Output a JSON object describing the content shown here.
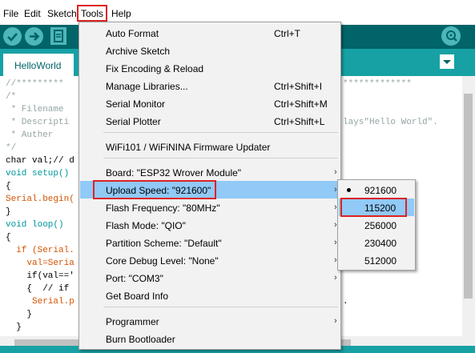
{
  "menubar": {
    "items": [
      "File",
      "Edit",
      "Sketch",
      "Tools",
      "Help"
    ]
  },
  "toolbar": {
    "buttons": [
      "verify-icon",
      "upload-icon",
      "new-icon",
      "serial-monitor-icon"
    ]
  },
  "tab": {
    "name": "HelloWorld"
  },
  "editor": {
    "lines": [
      {
        "text": "//*********",
        "cls": "c-com"
      },
      {
        "text": "/*",
        "cls": "c-com"
      },
      {
        "text": " * Filename",
        "cls": "c-com"
      },
      {
        "text": " * Descripti",
        "cls": "c-com"
      },
      {
        "text": " * Auther",
        "cls": "c-com"
      },
      {
        "text": "*/",
        "cls": "c-com"
      },
      {
        "text": "char val;// d",
        "cls": ""
      },
      {
        "text": "void setup()",
        "cls": "c-kw"
      },
      {
        "text": "{",
        "cls": ""
      },
      {
        "text": "Serial.begin(",
        "cls": "c-fn"
      },
      {
        "text": "}",
        "cls": ""
      },
      {
        "text": "void loop()",
        "cls": "c-kw"
      },
      {
        "text": "{",
        "cls": ""
      },
      {
        "text": "  if (Serial.",
        "cls": "c-fn"
      },
      {
        "text": "    val=Seria",
        "cls": "c-fn"
      },
      {
        "text": "    if(val=='",
        "cls": ""
      },
      {
        "text": "    {  // if",
        "cls": ""
      },
      {
        "text": "     Serial.p",
        "cls": "c-fn"
      },
      {
        "text": "    }",
        "cls": ""
      },
      {
        "text": "  }",
        "cls": ""
      }
    ],
    "right_fragments": {
      "stars": "*************",
      "hello": "lays\"Hello World\".",
      "dot": "."
    }
  },
  "tools_menu": {
    "items": [
      {
        "label": "Auto Format",
        "shortcut": "Ctrl+T",
        "submenu": false
      },
      {
        "label": "Archive Sketch",
        "shortcut": "",
        "submenu": false
      },
      {
        "label": "Fix Encoding & Reload",
        "shortcut": "",
        "submenu": false
      },
      {
        "label": "Manage Libraries...",
        "shortcut": "Ctrl+Shift+I",
        "submenu": false
      },
      {
        "label": "Serial Monitor",
        "shortcut": "Ctrl+Shift+M",
        "submenu": false
      },
      {
        "label": "Serial Plotter",
        "shortcut": "Ctrl+Shift+L",
        "submenu": false
      },
      {
        "label": "WiFi101 / WiFiNINA Firmware Updater",
        "shortcut": "",
        "submenu": false
      },
      {
        "label": "Board: \"ESP32 Wrover Module\"",
        "shortcut": "",
        "submenu": true
      },
      {
        "label": "Upload Speed: \"921600\"",
        "shortcut": "",
        "submenu": true
      },
      {
        "label": "Flash Frequency: \"80MHz\"",
        "shortcut": "",
        "submenu": true
      },
      {
        "label": "Flash Mode: \"QIO\"",
        "shortcut": "",
        "submenu": true
      },
      {
        "label": "Partition Scheme: \"Default\"",
        "shortcut": "",
        "submenu": true
      },
      {
        "label": "Core Debug Level: \"None\"",
        "shortcut": "",
        "submenu": true
      },
      {
        "label": "Port: \"COM3\"",
        "shortcut": "",
        "submenu": true
      },
      {
        "label": "Get Board Info",
        "shortcut": "",
        "submenu": false
      },
      {
        "label": "Programmer",
        "shortcut": "",
        "submenu": true
      },
      {
        "label": "Burn Bootloader",
        "shortcut": "",
        "submenu": false
      }
    ],
    "highlighted": "Upload Speed: \"921600\""
  },
  "upload_speed_submenu": {
    "options": [
      "921600",
      "115200",
      "256000",
      "230400",
      "512000"
    ],
    "checked": "921600",
    "hovered": "115200"
  },
  "colors": {
    "toolbar": "#006468",
    "tabbar": "#17a1a5",
    "button": "#4db7bb",
    "selection": "#91c9f7",
    "annotation": "#dd2222"
  }
}
